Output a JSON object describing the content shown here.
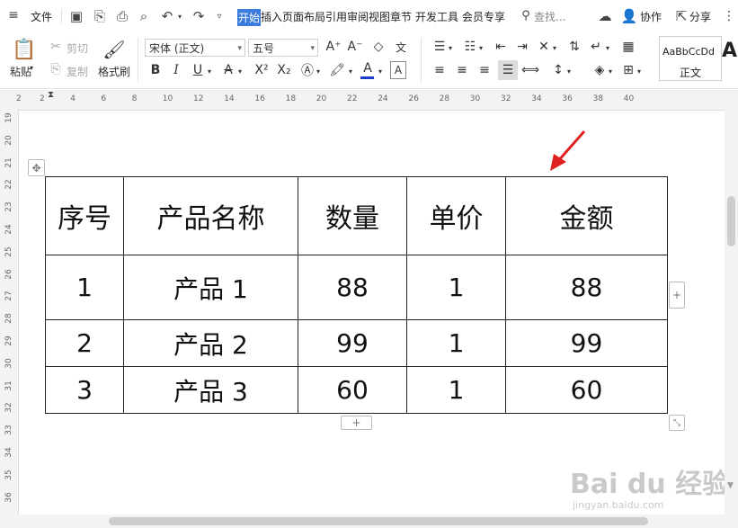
{
  "menubar": {
    "file": "文件",
    "tabs": [
      "开始",
      "插入",
      "页面布局",
      "引用",
      "审阅",
      "视图",
      "章节",
      "开发工具",
      "会员专享"
    ],
    "search": "查找...",
    "collab": "协作",
    "share": "分享"
  },
  "ribbon": {
    "paste": "粘贴",
    "cut": "剪切",
    "copy": "复制",
    "format_painter": "格式刷",
    "font_name": "宋体 (正文)",
    "font_size": "五号",
    "style_preview": "AaBbCcDd",
    "style_name": "正文",
    "style_preview2": "Aa"
  },
  "ruler": {
    "h_ticks": [
      "2",
      "2",
      "4",
      "6",
      "8",
      "10",
      "12",
      "14",
      "16",
      "18",
      "20",
      "22",
      "24",
      "26",
      "28",
      "30",
      "32",
      "34",
      "36",
      "38",
      "40"
    ],
    "v_ticks": [
      "19",
      "20",
      "21",
      "22",
      "23",
      "24",
      "25",
      "26",
      "27",
      "28",
      "29",
      "30",
      "31",
      "32",
      "33",
      "34",
      "35",
      "36"
    ]
  },
  "table": {
    "headers": [
      "序号",
      "产品名称",
      "数量",
      "单价",
      "金额"
    ],
    "rows": [
      [
        "1",
        "产品 1",
        "88",
        "1",
        "88"
      ],
      [
        "2",
        "产品 2",
        "99",
        "1",
        "99"
      ],
      [
        "3",
        "产品 3",
        "60",
        "1",
        "60"
      ]
    ]
  },
  "watermark": {
    "text": "Bai du 经验",
    "sub": "jingyan.baidu.com"
  },
  "colors": {
    "active_tab": "#3b7ddd",
    "arrow": "#e02020",
    "font_color_bar": "#1a3cc8"
  }
}
